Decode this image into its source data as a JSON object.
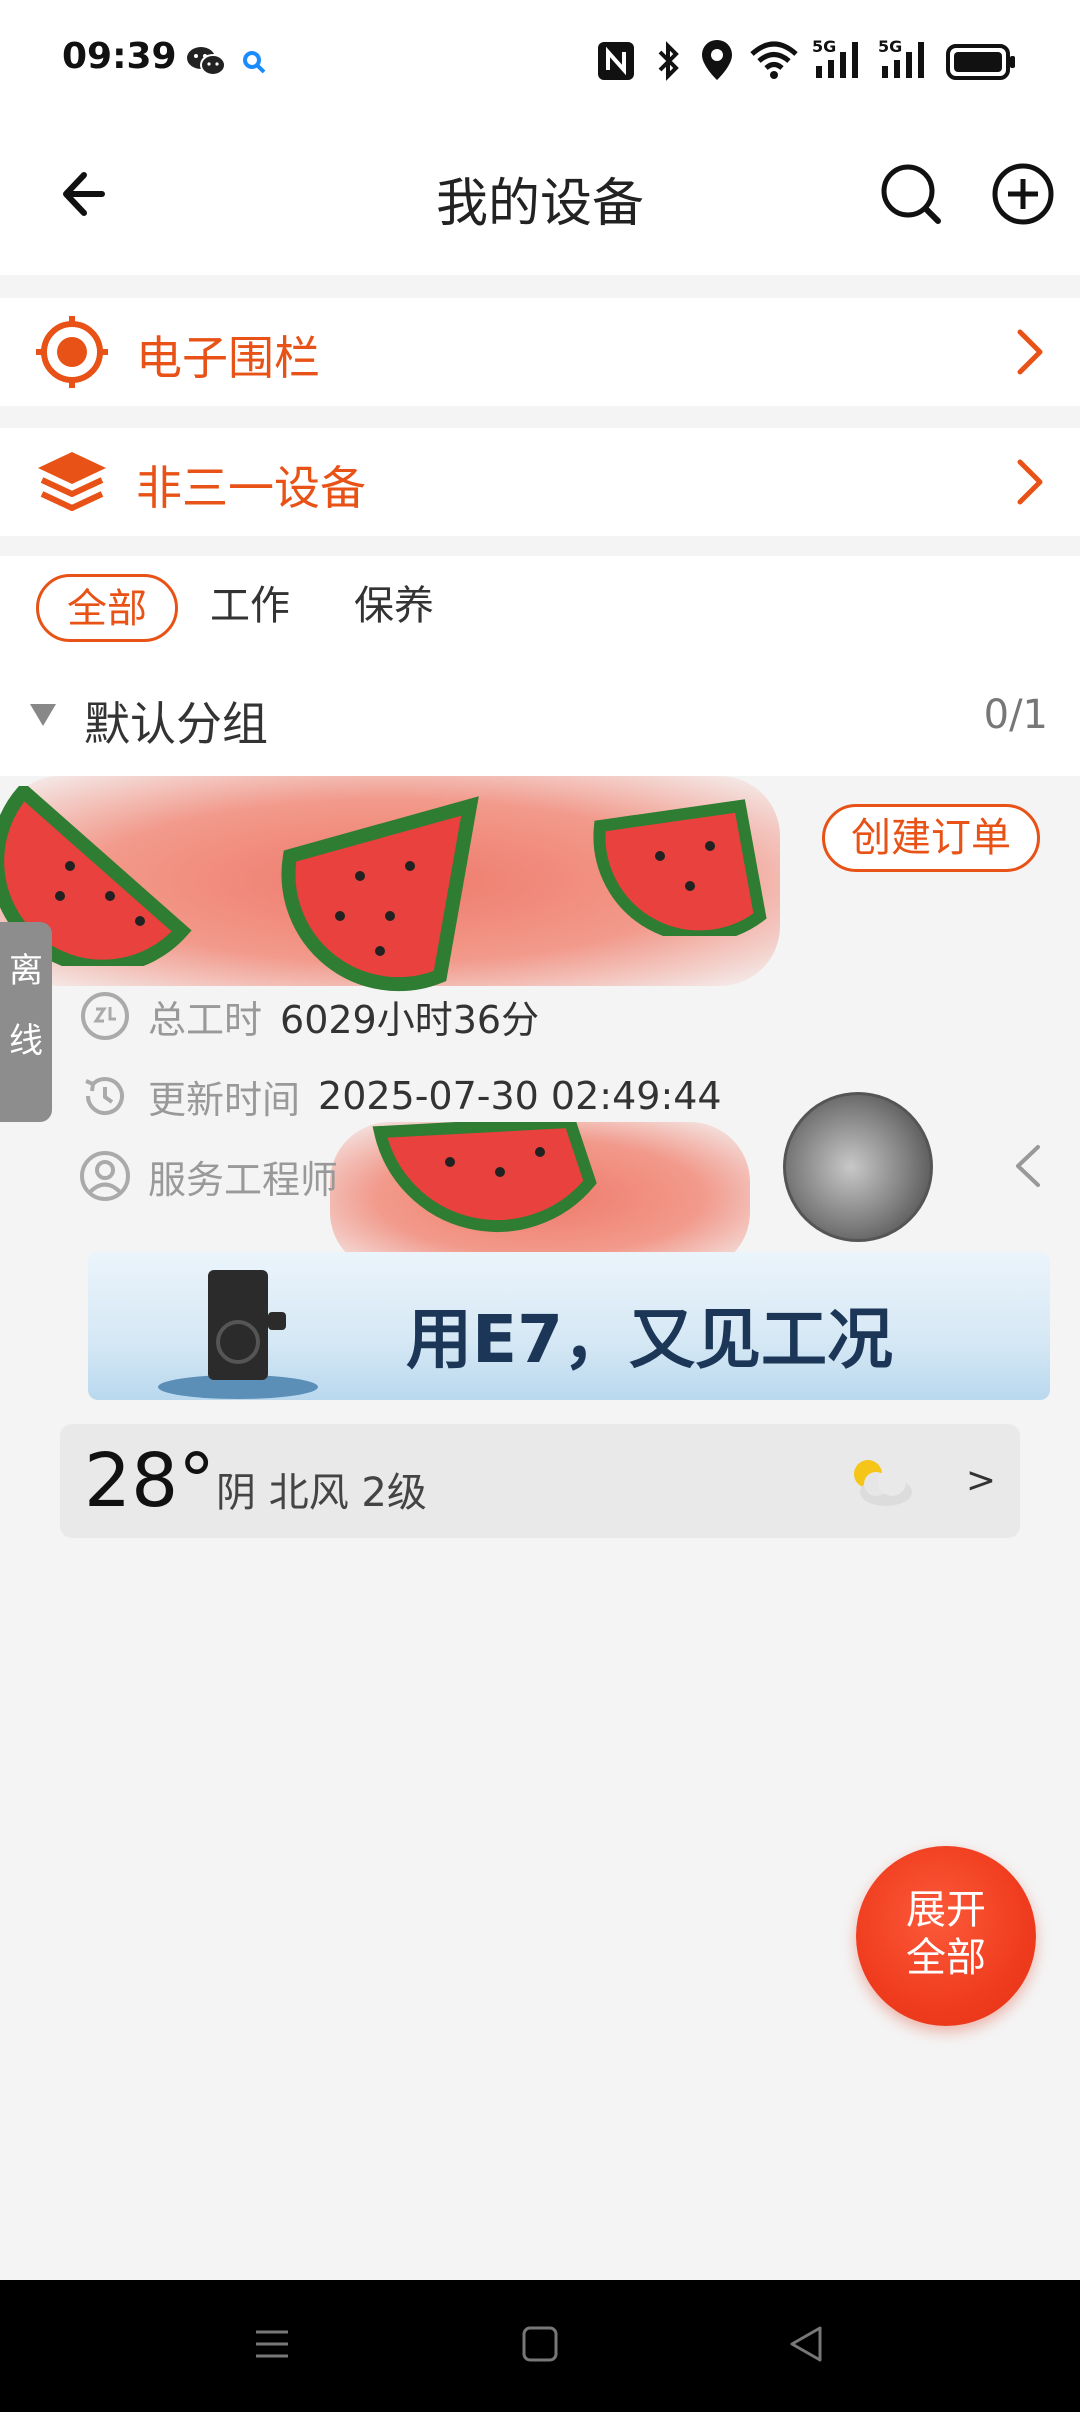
{
  "status_bar": {
    "time": "09:39",
    "icons": [
      "wechat-icon",
      "search-notification-icon",
      "nfc-icon",
      "bluetooth-icon",
      "location-icon",
      "wifi-icon",
      "signal-5g-icon",
      "signal-5g-icon",
      "battery-icon"
    ]
  },
  "header": {
    "title": "我的设备",
    "back_icon": "back-arrow-icon",
    "search_icon": "search-icon",
    "add_icon": "add-circle-icon"
  },
  "entries": [
    {
      "label": "电子围栏",
      "icon": "target-icon"
    },
    {
      "label": "非三一设备",
      "icon": "layers-icon"
    }
  ],
  "filter_tabs": [
    {
      "label": "全部",
      "active": true
    },
    {
      "label": "工作",
      "active": false
    },
    {
      "label": "保养",
      "active": false
    }
  ],
  "group": {
    "name": "默认分组",
    "count": "0/1"
  },
  "device_card": {
    "order_button": "创建订单",
    "status_tag": "离线",
    "total_hours_label": "总工时",
    "total_hours_value": "6029小时36分",
    "update_time_label": "更新时间",
    "update_time_value": "2025-07-30 02:49:44",
    "engineer_label": "服务工程师"
  },
  "banner": {
    "text": "用E7，又见工况"
  },
  "weather": {
    "temperature": "28°",
    "description": "阴  北风  2级",
    "more": ">"
  },
  "fab": {
    "line1": "展开",
    "line2": "全部"
  },
  "colors": {
    "accent": "#e85216",
    "fab": "#f03c1e",
    "offline_tag": "#8d8d8d",
    "background": "#f4f4f4"
  }
}
